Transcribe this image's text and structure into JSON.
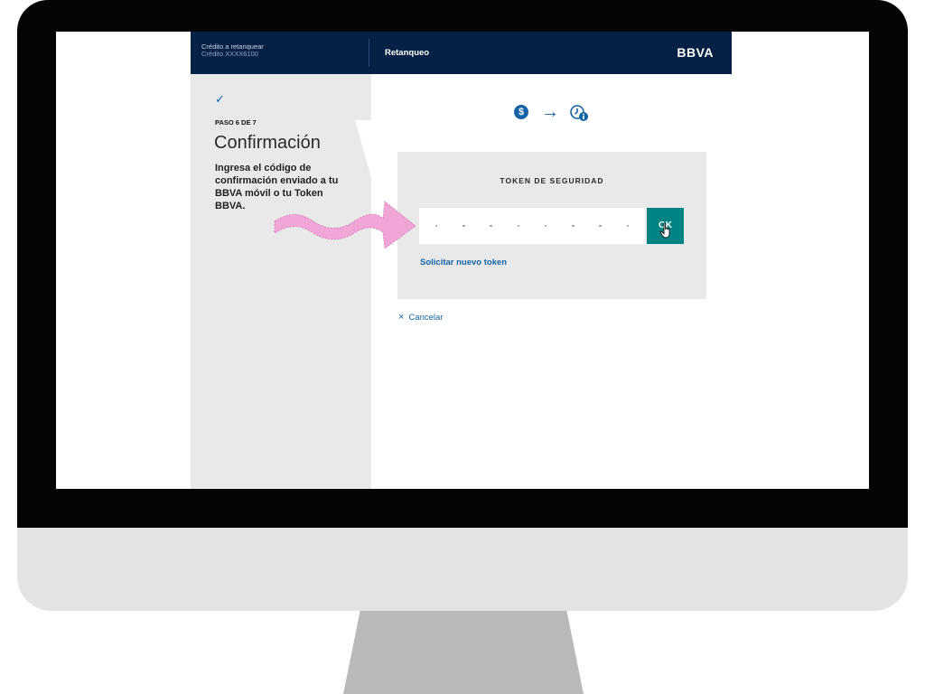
{
  "header": {
    "credit_title": "Crédito a retanquear",
    "credit_number": "Crédito XXXX6100",
    "section_title": "Retanqueo",
    "logo_text": "BBVA"
  },
  "sidebar": {
    "check_icon": "check-icon",
    "step_label": "PASO 6 DE 7",
    "step_title": "Confirmación",
    "step_description": "Ingresa el código de confirmación enviado a tu BBVA móvil o tu Token BBVA."
  },
  "icons": {
    "dollar_symbol": "$",
    "arrow_symbol": "→"
  },
  "token_card": {
    "title": "TOKEN DE SEGURIDAD",
    "input_value": "",
    "ok_label": "OK",
    "request_new_link": "Solicitar nuevo token"
  },
  "cancel": {
    "icon": "×",
    "label": "Cancelar"
  },
  "colors": {
    "header_bg": "#072146",
    "accent_blue": "#1464a5",
    "ok_button": "#028484",
    "panel_gray": "#e9e9e9",
    "annotation_pink": "#f0a6d6"
  }
}
